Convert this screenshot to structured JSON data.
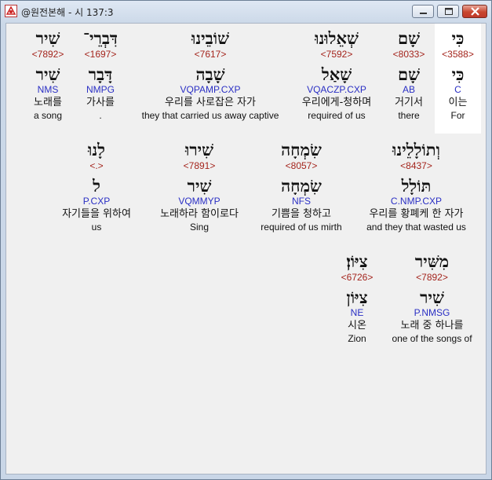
{
  "window": {
    "title": "@원전본해 - 시 137:3"
  },
  "verse": {
    "row1": [
      {
        "hebrew": "כִּי",
        "strong": "<3588>",
        "lemma": "כִּי",
        "morph": "C",
        "korean": "이는",
        "english": "For"
      },
      {
        "hebrew": "שָׁם",
        "strong": "<8033>",
        "lemma": "שָׁם",
        "morph": "AB",
        "korean": "거기서",
        "english": "there"
      },
      {
        "hebrew": "שְׁאֵלוּנוּ",
        "strong": "<7592>",
        "lemma": "שָׁאַל",
        "morph": "VQACZP.CXP",
        "korean": "우리에게-청하며",
        "english": "required of us"
      },
      {
        "hebrew": "שׁוֹבֵינוּ",
        "strong": "<7617>",
        "lemma": "שָׁבָה",
        "morph": "VQPAMP.CXP",
        "korean": "우리를 사로잡은 자가",
        "english": "they that carried us away captive"
      },
      {
        "hebrew": "דִּבְרֵי־",
        "strong": "<1697>",
        "lemma": "דָּבָר",
        "morph": "NMPG",
        "korean": "가사를",
        "english": "."
      },
      {
        "hebrew": "שִׁיר",
        "strong": "<7892>",
        "lemma": "שִׁיר",
        "morph": "NMS",
        "korean": "노래를",
        "english": "a song"
      }
    ],
    "row2": [
      {
        "hebrew": "וְתוֹלָלֵינוּ",
        "strong": "<8437>",
        "lemma": "תּוֹלָל",
        "morph": "C.NMP.CXP",
        "korean": "우리를 황폐케 한 자가",
        "english": "and they that wasted us"
      },
      {
        "hebrew": "שִׂמְחָה",
        "strong": "<8057>",
        "lemma": "שִׂמְחָה",
        "morph": "NFS",
        "korean": "기쁨을 청하고",
        "english": "required of us mirth"
      },
      {
        "hebrew": "שִׁירוּ",
        "strong": "<7891>",
        "lemma": "שִׁיר",
        "morph": "VQMMYP",
        "korean": "노래하라 함이로다",
        "english": "Sing"
      },
      {
        "hebrew": "לָנוּ",
        "strong": "<.>",
        "lemma": "ל",
        "morph": "P.CXP",
        "korean": "자기들을 위하여",
        "english": "us"
      }
    ],
    "row3": [
      {
        "hebrew": "מִשִּׁיר",
        "strong": "<7892>",
        "lemma": "שִׁיר",
        "morph": "P.NMSG",
        "korean": "노래 중 하나를",
        "english": "one of the songs of"
      },
      {
        "hebrew": "צִיּוֹן׃",
        "strong": "<6726>",
        "lemma": "צִיּוֹן",
        "morph": "NE",
        "korean": "시온",
        "english": "Zion"
      }
    ]
  }
}
